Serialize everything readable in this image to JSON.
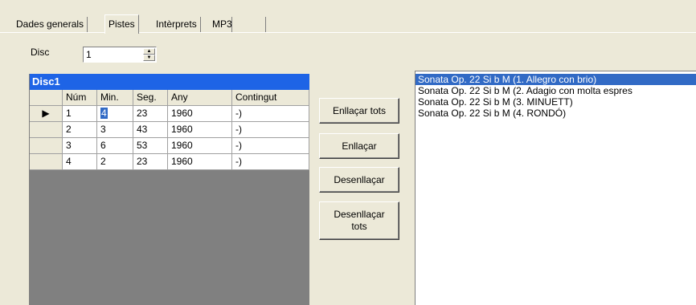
{
  "tabs": [
    {
      "label": "Dades generals"
    },
    {
      "label": "Pistes"
    },
    {
      "label": "Intèrprets"
    },
    {
      "label": "MP3"
    }
  ],
  "disc_selector": {
    "label": "Disc",
    "value": "1"
  },
  "grid": {
    "caption": "Disc1",
    "columns": [
      "Núm",
      "Min.",
      "Seg.",
      "Any",
      "Contingut"
    ],
    "rows": [
      {
        "indicator": "▶",
        "num": "1",
        "min": "4",
        "seg": "23",
        "any": "1960",
        "contingut": "-)"
      },
      {
        "indicator": "",
        "num": "2",
        "min": "3",
        "seg": "43",
        "any": "1960",
        "contingut": "-)"
      },
      {
        "indicator": "",
        "num": "3",
        "min": "6",
        "seg": "53",
        "any": "1960",
        "contingut": "-)"
      },
      {
        "indicator": "",
        "num": "4",
        "min": "2",
        "seg": "23",
        "any": "1960",
        "contingut": "-)"
      }
    ]
  },
  "buttons": {
    "link_all": "Enllaçar tots",
    "link": "Enllaçar",
    "unlink": "Desenllaçar",
    "unlink_all_line1": "Desenllaçar",
    "unlink_all_line2": "tots"
  },
  "track_list": [
    "Sonata Op. 22  Si b M (1. Allegro con brio)",
    "Sonata Op. 22   Si b M (2. Adagio con molta espres",
    "Sonata Op. 22  Si b M (3. MINUETT)",
    "Sonata Op. 22  Si b M (4. RONDÓ)"
  ],
  "colors": {
    "window_bg": "#ece9d8",
    "grid_caption_bg": "#1e64e6",
    "selection": "#316ac5"
  }
}
